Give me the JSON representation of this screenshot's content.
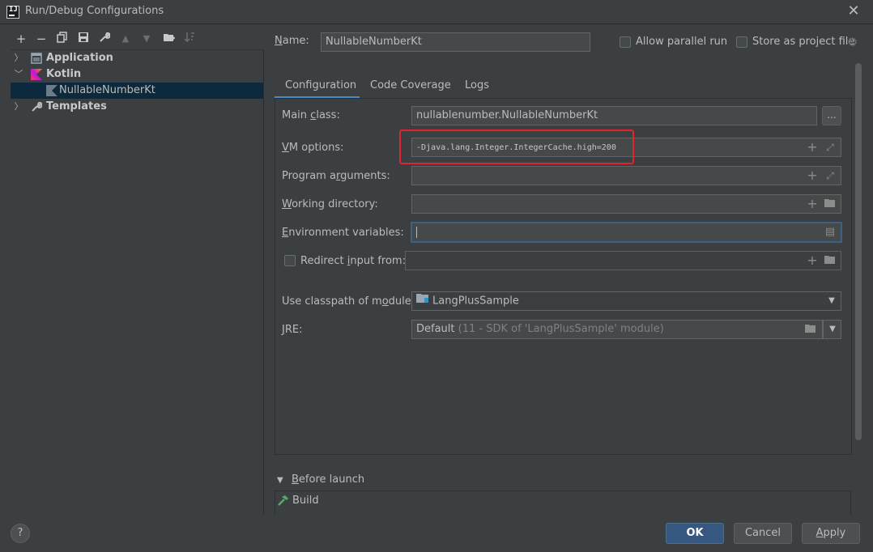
{
  "window": {
    "title": "Run/Debug Configurations",
    "app_logo": "IJ"
  },
  "toolbar": {
    "icons": [
      "add-icon",
      "remove-icon",
      "copy-icon",
      "save-icon",
      "wrench-icon",
      "move-up-icon",
      "move-down-icon",
      "new-folder-icon",
      "sort-icon"
    ]
  },
  "tree": {
    "items": [
      {
        "label": "Application",
        "icon": "application-icon",
        "expanded": false
      },
      {
        "label": "Kotlin",
        "icon": "kotlin-icon",
        "expanded": true
      },
      {
        "label": "NullableNumberKt",
        "icon": "kotlin-file-icon",
        "selected": true
      },
      {
        "label": "Templates",
        "icon": "wrench-icon",
        "expanded": false
      }
    ]
  },
  "header": {
    "name_label": "Name:",
    "name_value": "NullableNumberKt",
    "allow_parallel_label": "Allow parallel run",
    "store_project_label": "Store as project file"
  },
  "tabs": [
    {
      "label": "Configuration",
      "active": true
    },
    {
      "label": "Code Coverage",
      "active": false
    },
    {
      "label": "Logs",
      "active": false
    }
  ],
  "form": {
    "main_class_label": "Main class:",
    "main_class_value": "nullablenumber.NullableNumberKt",
    "main_class_button": "...",
    "vm_options_label": "VM options:",
    "vm_options_value": "-Djava.lang.Integer.IntegerCache.high=200",
    "program_args_label": "Program arguments:",
    "program_args_value": "",
    "working_dir_label": "Working directory:",
    "working_dir_value": "",
    "env_vars_label": "Environment variables:",
    "env_vars_value": "",
    "redirect_label": "Redirect input from:",
    "redirect_value": "",
    "classpath_label": "Use classpath of module:",
    "classpath_value": "LangPlusSample",
    "jre_label": "JRE:",
    "jre_value": "Default",
    "jre_detail": "(11 - SDK of 'LangPlusSample' module)"
  },
  "before_launch": {
    "label": "Before launch",
    "items": [
      {
        "label": "Build",
        "icon": "hammer-icon"
      }
    ]
  },
  "buttons": {
    "ok": "OK",
    "cancel": "Cancel",
    "apply": "Apply",
    "help": "?"
  },
  "colors": {
    "background": "#3c3f41",
    "selection": "#0d293e",
    "accent": "#4a88c7",
    "highlight_box": "#e0242c",
    "primary_button": "#365880"
  }
}
